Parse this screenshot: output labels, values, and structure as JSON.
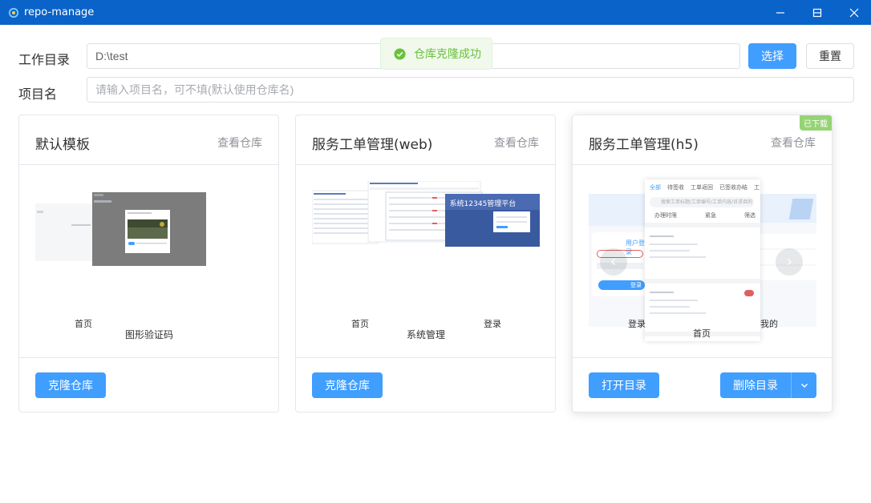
{
  "window": {
    "title": "repo-manage"
  },
  "form": {
    "workdir_label": "工作目录",
    "workdir_value": "D:\\test",
    "select_label": "选择",
    "reset_label": "重置",
    "project_label": "项目名",
    "project_placeholder": "请输入项目名，可不填(默认使用仓库名)"
  },
  "toast": {
    "message": "仓库克隆成功"
  },
  "cards": [
    {
      "title": "默认模板",
      "link": "查看仓库",
      "captions": [
        "首页"
      ],
      "caption_main": "图形验证码",
      "button": "克隆仓库"
    },
    {
      "title": "服务工单管理(web)",
      "link": "查看仓库",
      "captions": [
        "首页",
        "登录"
      ],
      "caption_main": "系统管理",
      "thumb_banner": "系统12345管理平台",
      "button": "克隆仓库"
    },
    {
      "title": "服务工单管理(h5)",
      "link": "查看仓库",
      "badge": "已下载",
      "captions": [
        "登录",
        "首页",
        "我的"
      ],
      "phone_tabs": [
        "全部",
        "待签收",
        "工单返回",
        "已签收办结",
        "工"
      ],
      "phone_search": "搜索工单标题/工单编号/工单内容/诉求目的",
      "phone_filters": [
        "办理时限",
        "紧急",
        "筛选"
      ],
      "login_title": "用户登录",
      "login_btn": "登录",
      "button_open": "打开目录",
      "button_delete": "删除目录"
    }
  ],
  "colors": {
    "titlebar": "#0a63c9",
    "primary": "#409eff",
    "success": "#67c23a",
    "badge": "#95d475"
  }
}
